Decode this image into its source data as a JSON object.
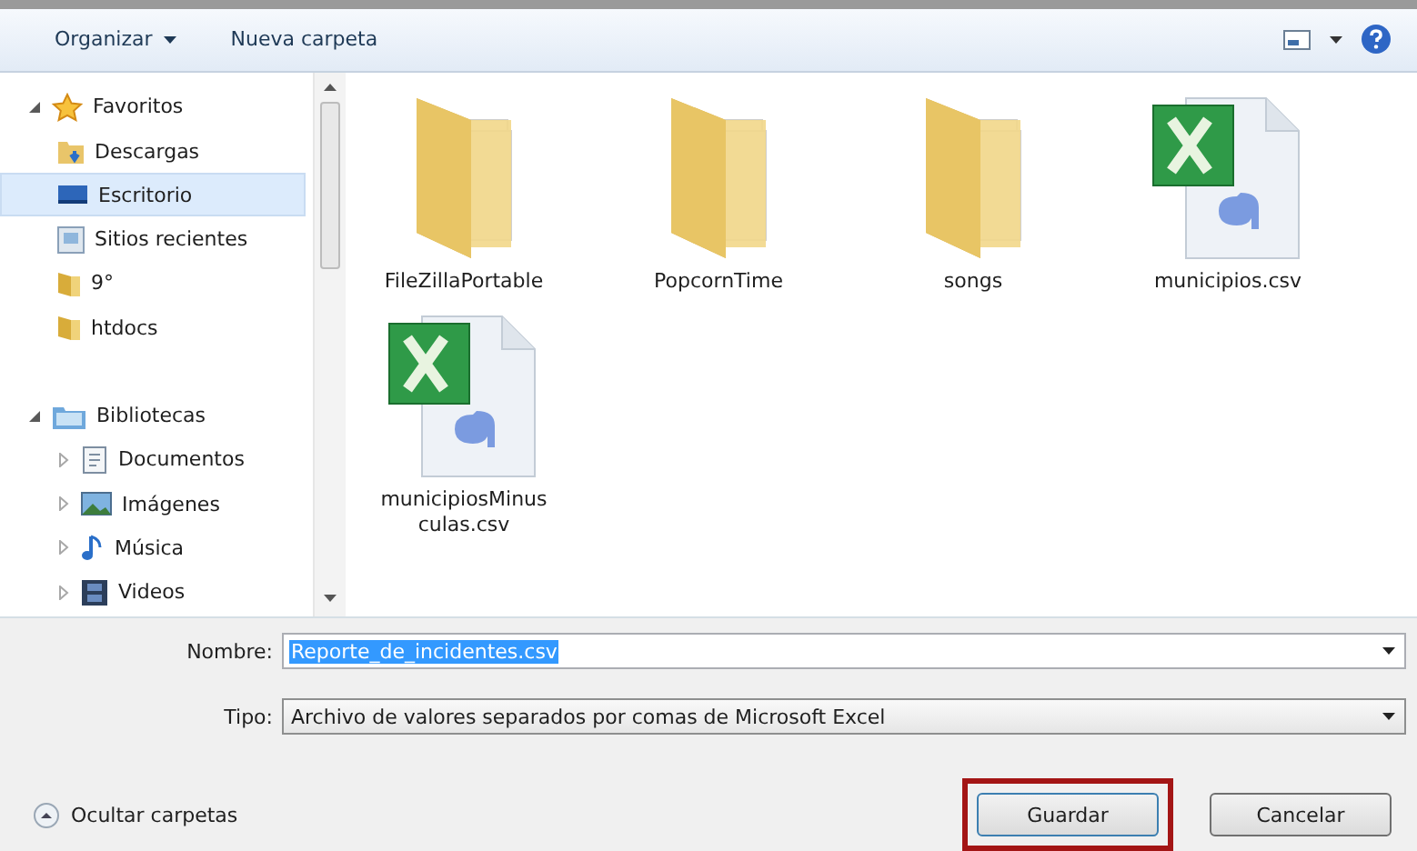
{
  "toolbar": {
    "organize": "Organizar",
    "new_folder": "Nueva carpeta"
  },
  "sidebar": {
    "groups": [
      {
        "label": "Favoritos",
        "kind": "favorites",
        "expanded": true,
        "children": [
          {
            "label": "Descargas",
            "kind": "downloads",
            "selected": false
          },
          {
            "label": "Escritorio",
            "kind": "desktop",
            "selected": true
          },
          {
            "label": "Sitios recientes",
            "kind": "recent",
            "selected": false
          },
          {
            "label": "9°",
            "kind": "folder",
            "selected": false
          },
          {
            "label": "htdocs",
            "kind": "folder",
            "selected": false
          }
        ]
      },
      {
        "label": "Bibliotecas",
        "kind": "libraries",
        "expanded": true,
        "children": [
          {
            "label": "Documentos",
            "kind": "documents",
            "selected": false,
            "expanded": false
          },
          {
            "label": "Imágenes",
            "kind": "pictures",
            "selected": false,
            "expanded": false
          },
          {
            "label": "Música",
            "kind": "music",
            "selected": false,
            "expanded": false
          },
          {
            "label": "Videos",
            "kind": "videos",
            "selected": false,
            "expanded": false
          }
        ]
      }
    ]
  },
  "files": [
    {
      "name": "FileZillaPortable",
      "kind": "folder"
    },
    {
      "name": "PopcornTime",
      "kind": "folder"
    },
    {
      "name": "songs",
      "kind": "folder"
    },
    {
      "name": "municipios.csv",
      "kind": "csv"
    },
    {
      "name": "municipiosMinusculas.csv",
      "kind": "csv"
    }
  ],
  "form": {
    "name_label": "Nombre:",
    "name_value": "Reporte_de_incidentes.csv",
    "name_selected": true,
    "type_label": "Tipo:",
    "type_value": "Archivo de valores separados por comas de Microsoft Excel"
  },
  "hide_folders": "Ocultar carpetas",
  "buttons": [
    {
      "label": "Guardar",
      "outlined": true
    },
    {
      "label": "Cancelar",
      "outlined": false
    }
  ]
}
